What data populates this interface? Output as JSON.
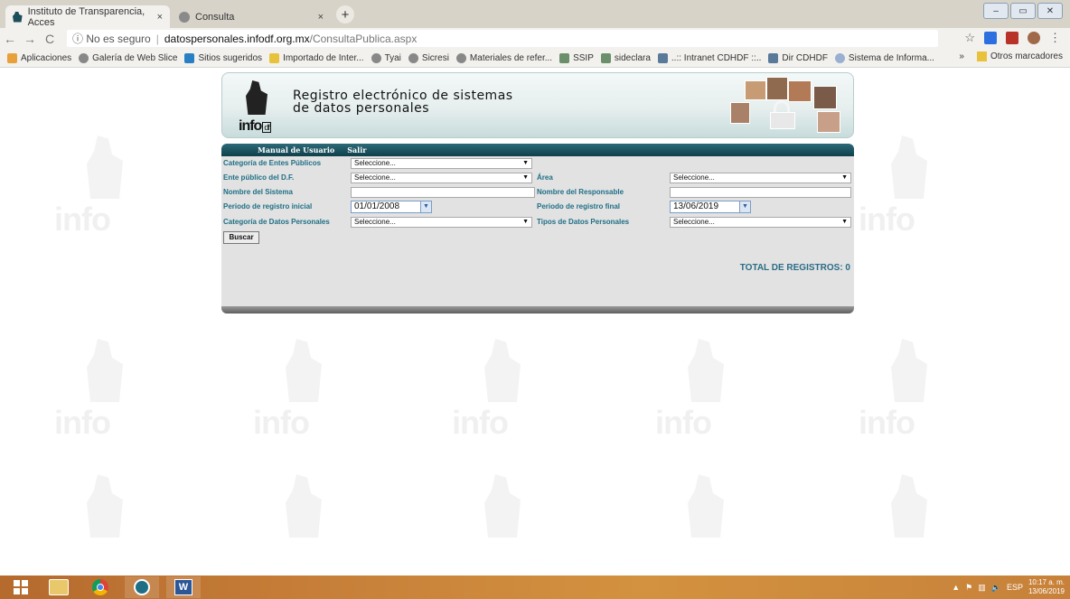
{
  "browser": {
    "tabs": [
      {
        "title": "Instituto de Transparencia, Acces",
        "close": "×",
        "active": true
      },
      {
        "title": "Consulta",
        "close": "×",
        "active": false
      }
    ],
    "new_tab": "+",
    "window_controls": [
      "–",
      "▭",
      "✕"
    ],
    "nav": {
      "back": "←",
      "forward": "→",
      "reload": "C"
    },
    "address": {
      "security": "ⓘ No es seguro",
      "separator": "|",
      "host": "datospersonales.infodf.org.mx",
      "path": "/ConsultaPublica.aspx"
    },
    "toolbar_icons": [
      "star-icon",
      "dropbox-icon",
      "pdf-icon",
      "profile-icon",
      "menu-icon"
    ],
    "bookmarks": [
      {
        "label": "Aplicaciones",
        "icon": "apps-icon",
        "color": "#e8a13a"
      },
      {
        "label": "Galería de Web Slice",
        "icon": "globe-icon",
        "color": "#888888"
      },
      {
        "label": "Sitios sugeridos",
        "icon": "bing-icon",
        "color": "#2a7fc4"
      },
      {
        "label": "Importado de Inter...",
        "icon": "folder-icon",
        "color": "#e8c23a"
      },
      {
        "label": "Tyai",
        "icon": "globe-icon",
        "color": "#888888"
      },
      {
        "label": "Sicresi",
        "icon": "globe-icon",
        "color": "#888888"
      },
      {
        "label": "Materiales de refer...",
        "icon": "globe-icon",
        "color": "#888888"
      },
      {
        "label": "SSIP",
        "icon": "page-icon",
        "color": "#6b8f6b"
      },
      {
        "label": "sideclara",
        "icon": "page-icon",
        "color": "#6b8f6b"
      },
      {
        "label": "..:: Intranet CDHDF ::..",
        "icon": "page-icon",
        "color": "#5a7a9a"
      },
      {
        "label": "Dir CDHDF",
        "icon": "page-icon",
        "color": "#5a7a9a"
      },
      {
        "label": "Sistema de Informa...",
        "icon": "globe-icon",
        "color": "#9ab0d0"
      }
    ],
    "bookmarks_more": "»",
    "bookmarks_other": "Otros marcadores"
  },
  "watermark_text": "info",
  "app": {
    "logo_text": "info",
    "logo_sub": "df",
    "title_line1": "Registro electrónico de sistemas",
    "title_line2": "de datos personales",
    "menu": [
      "Manual de Usuario",
      "Salir"
    ],
    "form": {
      "categoria_entes_label": "Categoría de Entes Públicos",
      "categoria_entes_value": "Seleccione...",
      "ente_label": "Ente público del D.F.",
      "ente_value": "Seleccione...",
      "area_label": "Área",
      "area_value": "Seleccione...",
      "nombre_sistema_label": "Nombre del Sistema",
      "nombre_sistema_value": "",
      "nombre_responsable_label": "Nombre del Responsable",
      "nombre_responsable_value": "",
      "periodo_inicial_label": "Periodo de registro inicial",
      "periodo_inicial_value": "01/01/2008",
      "periodo_final_label": "Periodo de registro final",
      "periodo_final_value": "13/06/2019",
      "categoria_datos_label": "Categoría de Datos Personales",
      "categoria_datos_value": "Seleccione...",
      "tipos_datos_label": "Tipos de Datos Personales",
      "tipos_datos_value": "Seleccione...",
      "buscar_label": "Buscar"
    },
    "total_label": "TOTAL DE REGISTROS: 0"
  },
  "taskbar": {
    "apps": [
      "windows-start-icon",
      "file-explorer-icon",
      "chrome-icon",
      "infodf-icon",
      "word-icon"
    ],
    "tray": {
      "language": "ESP",
      "time": "10:17 a. m.",
      "date": "13/06/2019"
    }
  },
  "colors": {
    "accent_teal": "#1e6f86",
    "menubar": "#0f3f4b",
    "panel": "#e2e2e2"
  }
}
